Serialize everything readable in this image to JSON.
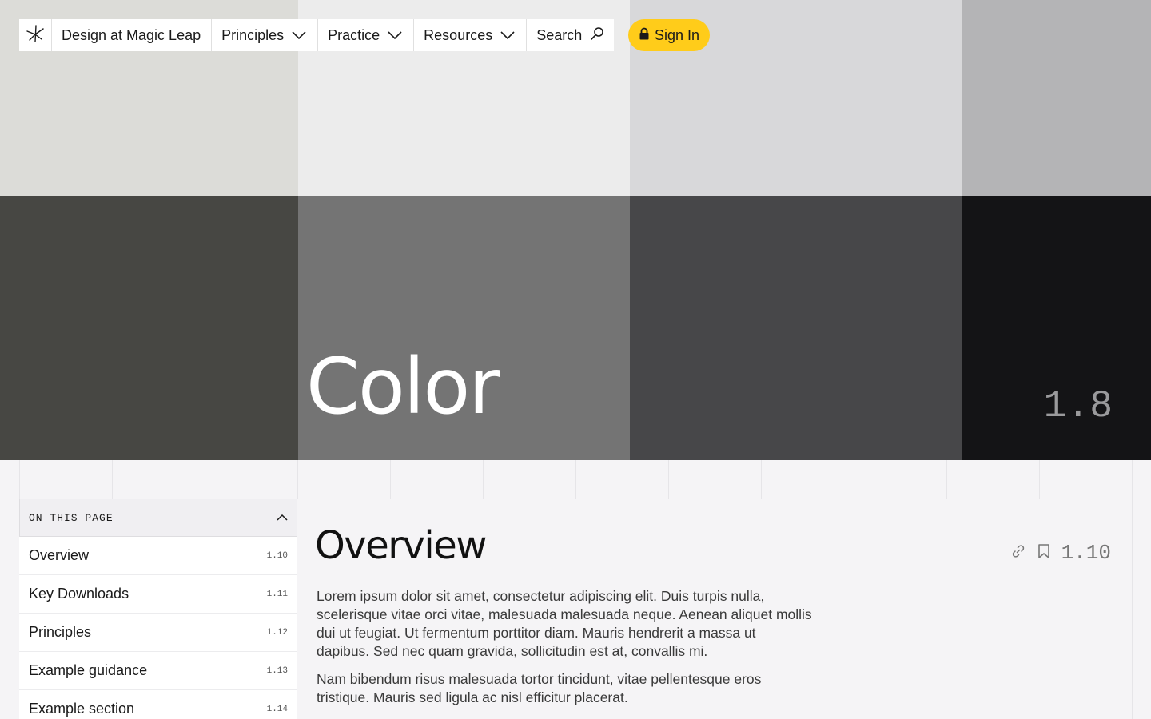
{
  "nav": {
    "brand": "Design at Magic Leap",
    "menus": [
      {
        "label": "Principles"
      },
      {
        "label": "Practice"
      },
      {
        "label": "Resources"
      }
    ],
    "search_label": "Search",
    "signin_label": "Sign In"
  },
  "hero": {
    "title": "Color",
    "section_number": "1.8",
    "swatches": {
      "top": [
        "#dcdcd8",
        "#ececec",
        "#d8d8da",
        "#b4b4b6"
      ],
      "bottom": [
        "#474743",
        "#747474",
        "#474749",
        "#141416"
      ]
    }
  },
  "toc": {
    "header": "ON THIS PAGE",
    "items": [
      {
        "label": "Overview",
        "num": "1.10"
      },
      {
        "label": "Key Downloads",
        "num": "1.11"
      },
      {
        "label": "Principles",
        "num": "1.12"
      },
      {
        "label": "Example guidance",
        "num": "1.13"
      },
      {
        "label": "Example section",
        "num": "1.14"
      }
    ]
  },
  "content": {
    "heading": "Overview",
    "section_number": "1.10",
    "paragraphs": [
      "Lorem ipsum dolor sit amet, consectetur adipiscing elit. Duis turpis nulla, scelerisque vitae orci vitae, malesuada malesuada neque. Aenean aliquet mollis dui ut feugiat. Ut fermentum porttitor diam. Mauris hendrerit a massa ut dapibus. Sed nec quam gravida, sollicitudin est at, convallis mi.",
      "Nam bibendum risus malesuada tortor tincidunt, vitae pellentesque eros tristique. Mauris sed ligula ac nisl efficitur placerat."
    ]
  },
  "colors": {
    "accent": "#ffcc1a"
  }
}
